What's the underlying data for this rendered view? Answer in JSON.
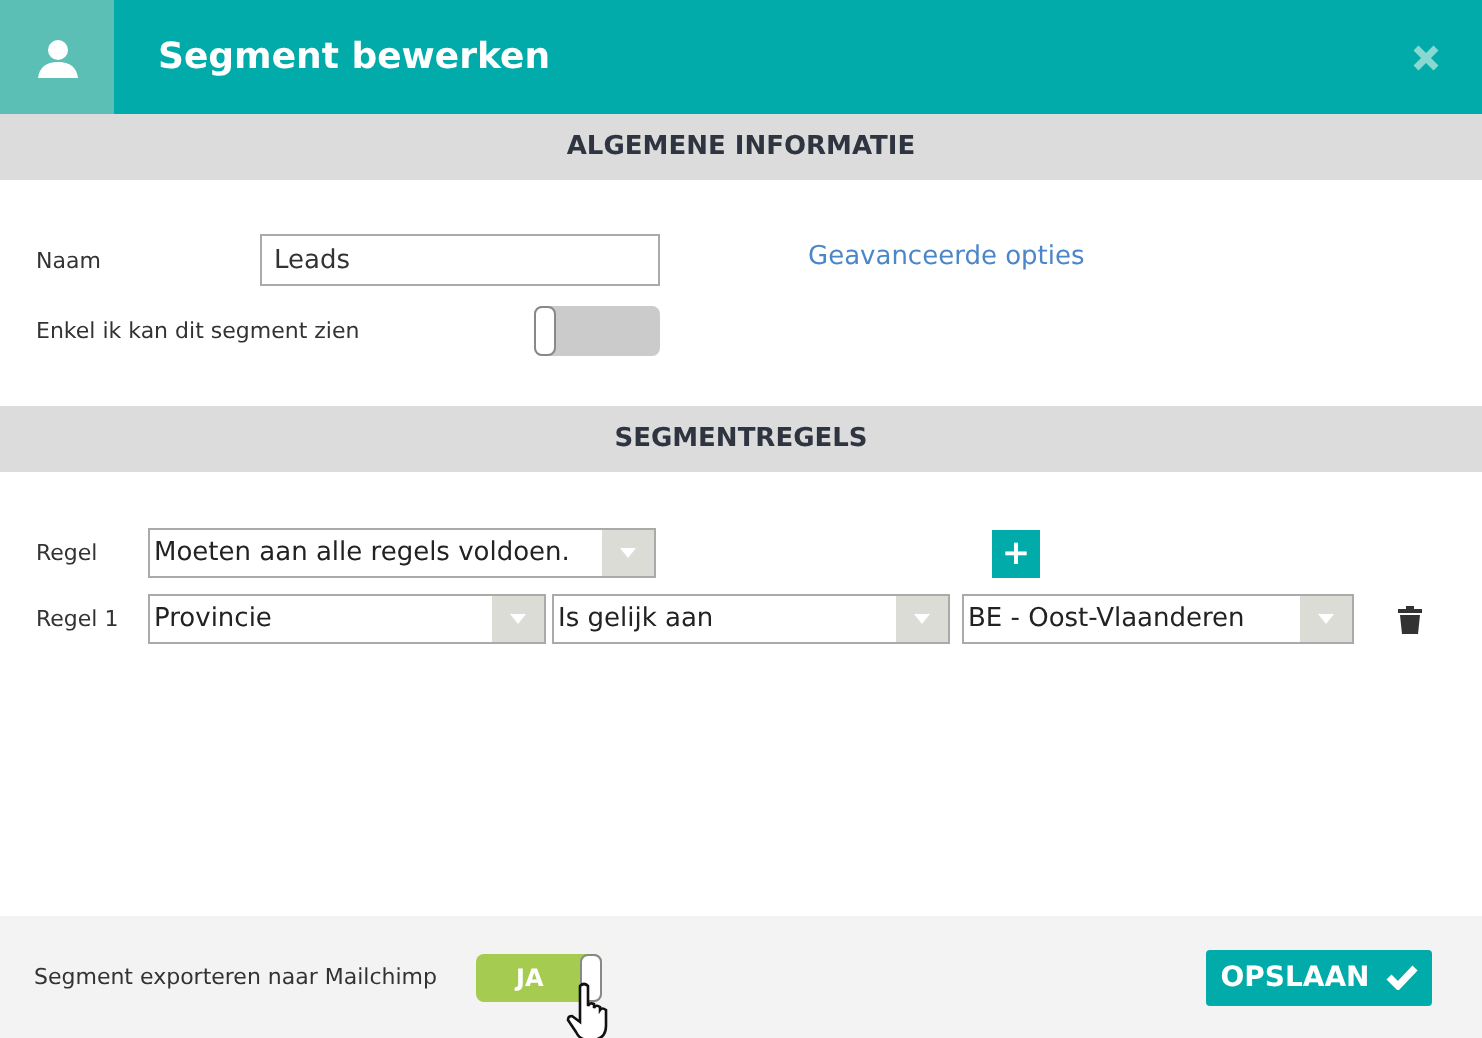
{
  "window": {
    "title": "Segment bewerken"
  },
  "sections": [
    {
      "title": "ALGEMENE INFORMATIE"
    },
    {
      "title": "SEGMENTREGELS"
    }
  ],
  "general": {
    "name_label": "Naam",
    "name_value": "Leads",
    "advanced_link": "Geavanceerde opties",
    "private_label": "Enkel ik kan dit segment zien",
    "private_on": false
  },
  "rules": {
    "match_label": "Regel",
    "match_value": "Moeten aan alle regels voldoen.",
    "add_button": "+",
    "items": [
      {
        "label": "Regel 1",
        "field": "Provincie",
        "operator": "Is gelijk aan",
        "value": "BE - Oost-Vlaanderen"
      }
    ]
  },
  "footer": {
    "export_label": "Segment exporteren naar Mailchimp",
    "export_on": true,
    "export_toggle_text": "JA",
    "save_button": "OPSLAAN"
  }
}
